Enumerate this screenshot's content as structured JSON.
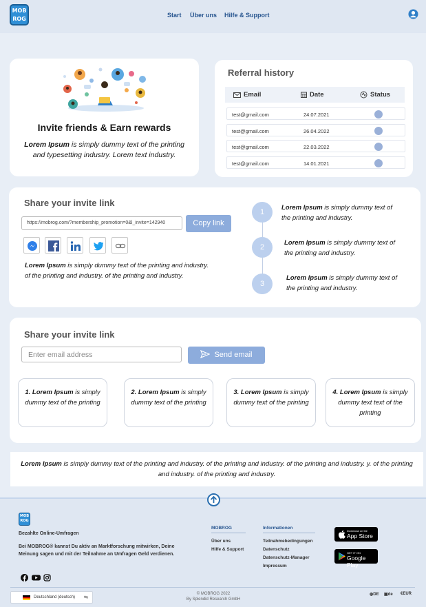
{
  "header": {
    "logo_text": "MOB ROG",
    "nav": [
      "Start",
      "Über uns",
      "Hilfe & Support"
    ],
    "user_icon": "user-circle-icon"
  },
  "invite": {
    "title": "Invite friends & Earn rewards",
    "desc_bold": "Lorem Ipsum",
    "desc_rest": " is simply dummy text of the printing and typesetting industry. Lorem text industry."
  },
  "referral": {
    "title": "Referral history",
    "columns": [
      "Email",
      "Date",
      "Status"
    ],
    "rows": [
      {
        "email": "test@gmail.com",
        "date": "24.07.2021"
      },
      {
        "email": "test@gmail.com",
        "date": "26.04.2022"
      },
      {
        "email": "test@gmail.com",
        "date": "22.03.2022"
      },
      {
        "email": "test@gmail.com",
        "date": "14.01.2021"
      }
    ]
  },
  "share": {
    "title": "Share your invite link",
    "link_value": "https://mobrog.com/?membership_promotion=0&l_invite=142940",
    "copy_button": "Copy link",
    "social_icons": [
      "messenger-icon",
      "facebook-icon",
      "linkedin-icon",
      "twitter-icon",
      "link-icon"
    ],
    "desc_bold": "Lorem Ipsum",
    "desc_rest": " is simply dummy text of the printing and industry. of the printing and industry. of the printing and industry.",
    "steps": [
      {
        "num": "1",
        "bold": "Lorem Ipsum",
        "rest": " is simply dummy text of the printing and industry."
      },
      {
        "num": "2",
        "bold": "Lorem Ipsum",
        "rest": " is simply dummy text of the printing and industry."
      },
      {
        "num": "3",
        "bold": "Lorem Ipsum",
        "rest": " is simply dummy text of the printing and industry."
      }
    ]
  },
  "email": {
    "title": "Share your invite link",
    "placeholder": "Enter email address",
    "send_button": "Send email",
    "boxes": [
      {
        "bold": "1. Lorem Ipsum",
        "rest": " is simply dummy text of the printing"
      },
      {
        "bold": "2. Lorem Ipsum",
        "rest": " is simply dummy text of the printing"
      },
      {
        "bold": "3. Lorem Ipsum",
        "rest": " is simply dummy text of the printing"
      },
      {
        "bold": "4. Lorem Ipsum",
        "rest": " is simply dummy text text of the printing"
      }
    ]
  },
  "strip": {
    "bold": "Lorem Ipsum",
    "rest": " is simply dummy text of the printing and industry. of the printing and industry. of the printing and industry. y. of the printing and industry. of the printing and industry."
  },
  "footer": {
    "logo_text": "MOB ROG",
    "subtitle": "Bezahlte Online-Umfragen",
    "desc": "Bei MOBROG® kannst Du aktiv an Marktforschung mitwirken, Deine Meinung sagen und mit der Teilnahme an Umfragen Geld verdienen.",
    "col1_title": "MOBROG",
    "col1_links": [
      "Über uns",
      "Hilfe & Support"
    ],
    "col2_title": "Informationen",
    "col2_links": [
      "Teilnahmebedingungen",
      "Datenschutz",
      "Datenschutz-Manager",
      "Impressum"
    ],
    "appstore_small": "Download on the",
    "appstore_big": "App Store",
    "googleplay_small": "GET IT ON",
    "googleplay_big": "Google Play",
    "social": [
      "facebook-icon",
      "youtube-icon",
      "instagram-icon"
    ],
    "language": "Deutschland (deutsch)",
    "copyright_1": "© MOBROG 2022",
    "copyright_2": "By Splendid Research GmbH",
    "meta": [
      "DE",
      "de",
      "EUR"
    ]
  }
}
